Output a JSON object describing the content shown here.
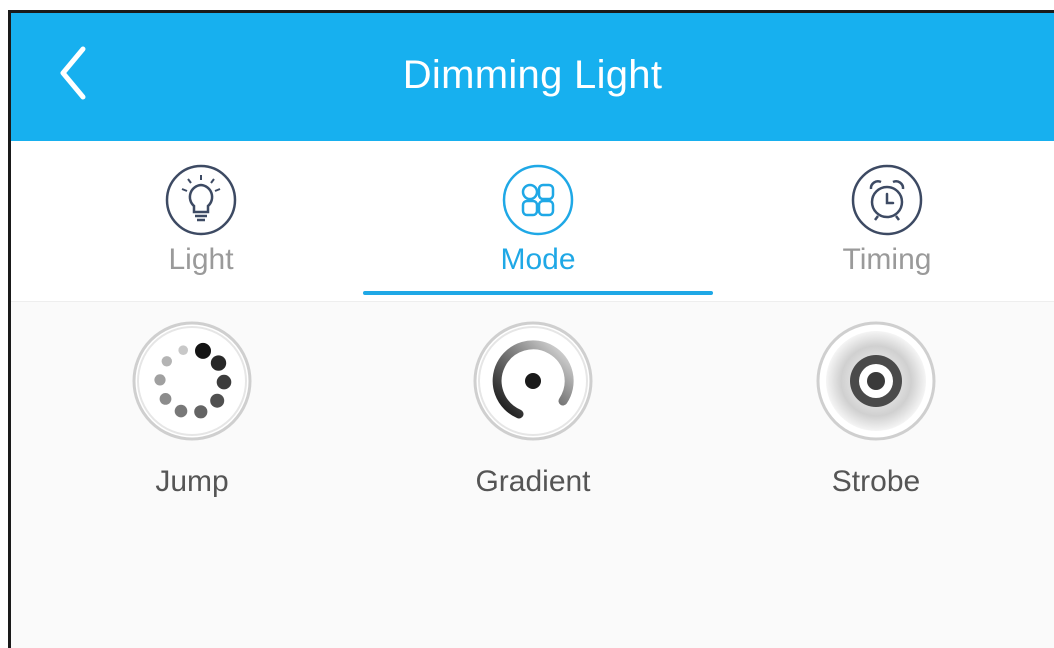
{
  "header": {
    "title": "Dimming Light",
    "back_icon": "chevron-left-icon",
    "background_color": "#17b0ef"
  },
  "tabs": [
    {
      "label": "Light",
      "icon": "lightbulb-icon",
      "active": false
    },
    {
      "label": "Mode",
      "icon": "grid-modes-icon",
      "active": true
    },
    {
      "label": "Timing",
      "icon": "alarm-clock-icon",
      "active": false
    }
  ],
  "modes": [
    {
      "label": "Jump",
      "icon": "jump-dots-icon"
    },
    {
      "label": "Gradient",
      "icon": "gradient-ring-icon"
    },
    {
      "label": "Strobe",
      "icon": "strobe-target-icon"
    }
  ],
  "colors": {
    "accent": "#1fa8e6",
    "inactive_text": "#9a9a9a",
    "mode_text": "#555555"
  }
}
